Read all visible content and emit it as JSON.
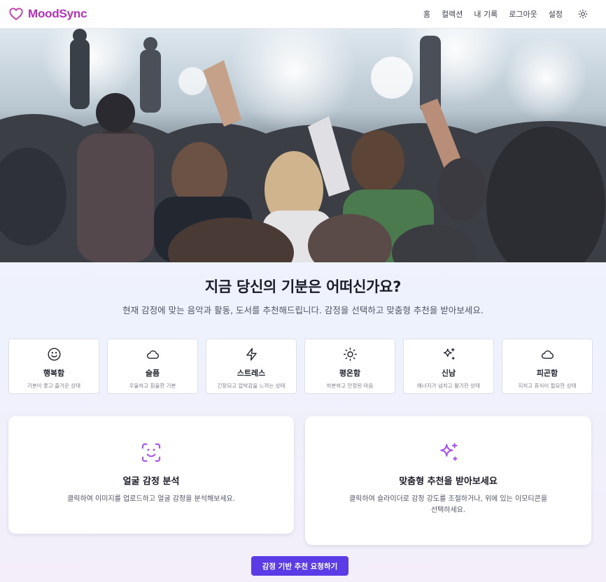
{
  "brand": {
    "name": "MoodSync",
    "accent": "#b531b8"
  },
  "nav": {
    "items": [
      "홈",
      "컬렉션",
      "내 기록",
      "로그아웃",
      "설정"
    ],
    "theme_icon": "sun-icon"
  },
  "hero": {
    "image": "concert-crowd-photo"
  },
  "heading": {
    "title": "지금 당신의 기분은 어떠신가요?",
    "subtitle": "현재 감정에 맞는 음악과 활동, 도서를 추천해드립니다. 감정을 선택하고 맞춤형 추천을 받아보세요."
  },
  "moods": [
    {
      "name": "행복함",
      "desc": "기분이 좋고 즐거운 상태",
      "icon": "smile-icon"
    },
    {
      "name": "슬픔",
      "desc": "우울하고 침울한 기분",
      "icon": "cloud-icon"
    },
    {
      "name": "스트레스",
      "desc": "긴장되고 압박감을 느끼는 상태",
      "icon": "lightning-icon"
    },
    {
      "name": "평온함",
      "desc": "차분하고 안정된 마음",
      "icon": "sun-icon"
    },
    {
      "name": "신남",
      "desc": "에너지가 넘치고 활기찬 상태",
      "icon": "sparkle-icon"
    },
    {
      "name": "피곤함",
      "desc": "지치고 휴식이 필요한 상태",
      "icon": "cloud-icon"
    }
  ],
  "features": {
    "face": {
      "title": "얼굴 감정 분석",
      "desc": "클릭하여 이미지를 업로드하고 얼굴 감정을 분석해보세요.",
      "icon": "face-scan-icon"
    },
    "custom": {
      "title": "맞춤형 추천을 받아보세요",
      "desc": "클릭하여 슬라이더로 감정 강도를 조절하거나, 위에 있는 이모티콘을 선택하세요.",
      "icon": "sparkle-icon"
    },
    "icon_color": "#a855f7"
  },
  "cta": {
    "label": "감정 기반 추천 요청하기",
    "color": "#5b3be6"
  }
}
